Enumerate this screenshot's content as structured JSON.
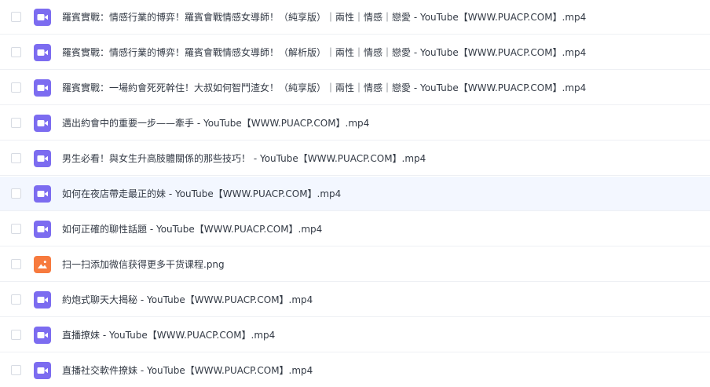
{
  "files": [
    {
      "name": "羅賓實戰：情感行業的博弈！羅賓會戰情感女導師！（純享版）｜兩性｜情感｜戀愛 - YouTube【WWW.PUACP.COM】.mp4",
      "type": "video",
      "icon": "video-file-icon"
    },
    {
      "name": "羅賓實戰：情感行業的博弈！羅賓會戰情感女導師！（解析版）｜兩性｜情感｜戀愛 - YouTube【WWW.PUACP.COM】.mp4",
      "type": "video",
      "icon": "video-file-icon"
    },
    {
      "name": "羅賓實戰：一場約會死死幹住！大叔如何智鬥渣女！（純享版）｜兩性｜情感｜戀愛 - YouTube【WWW.PUACP.COM】.mp4",
      "type": "video",
      "icon": "video-file-icon"
    },
    {
      "name": "邁出約會中的重要一步——牽手 - YouTube【WWW.PUACP.COM】.mp4",
      "type": "video",
      "icon": "video-file-icon"
    },
    {
      "name": "男生必看！與女生升高肢體關係的那些技巧！ - YouTube【WWW.PUACP.COM】.mp4",
      "type": "video",
      "icon": "video-file-icon"
    },
    {
      "name": "如何在夜店帶走最正的妹 - YouTube【WWW.PUACP.COM】.mp4",
      "type": "video",
      "icon": "video-file-icon"
    },
    {
      "name": "如何正確的聊性話題 - YouTube【WWW.PUACP.COM】.mp4",
      "type": "video",
      "icon": "video-file-icon"
    },
    {
      "name": "扫一扫添加微信获得更多干货课程.png",
      "type": "image",
      "icon": "image-file-icon"
    },
    {
      "name": "約炮式聊天大揭秘 - YouTube【WWW.PUACP.COM】.mp4",
      "type": "video",
      "icon": "video-file-icon"
    },
    {
      "name": "直播撩妹 - YouTube【WWW.PUACP.COM】.mp4",
      "type": "video",
      "icon": "video-file-icon"
    },
    {
      "name": "直播社交軟件撩妹 - YouTube【WWW.PUACP.COM】.mp4",
      "type": "video",
      "icon": "video-file-icon"
    }
  ],
  "colors": {
    "video_icon": "#7c6cf0",
    "image_icon": "#f77a3e",
    "hover_row": "#f3f7ff"
  }
}
